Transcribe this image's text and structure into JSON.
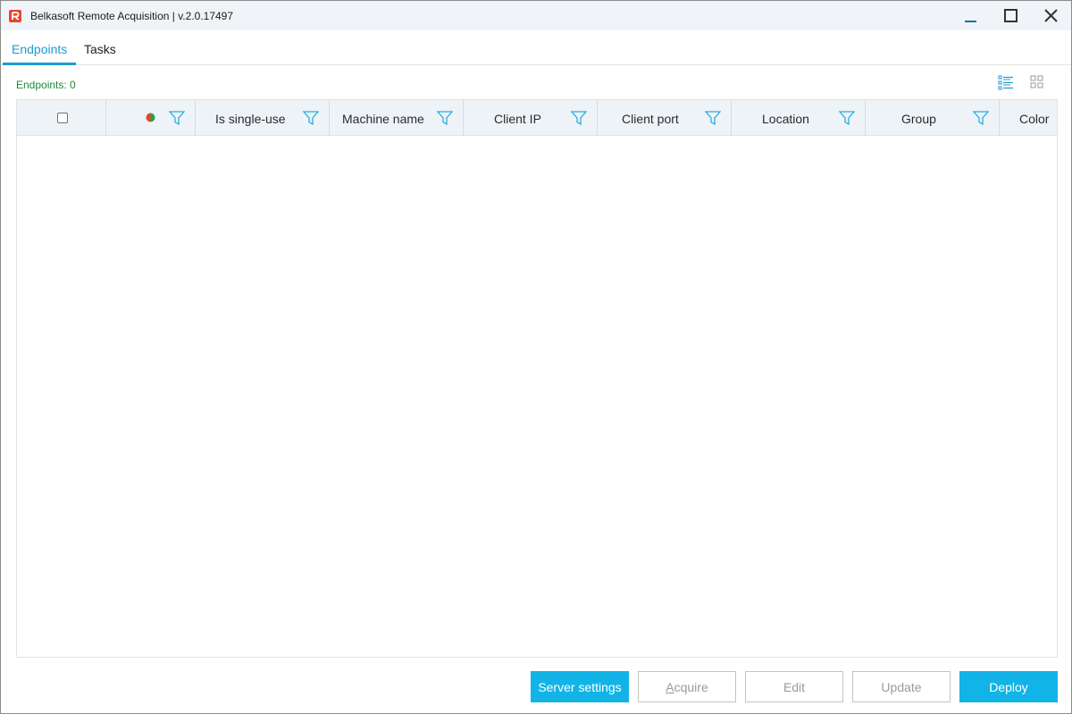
{
  "window": {
    "title": "Belkasoft Remote Acquisition | v.2.0.17497",
    "brand_color": "#e8452c",
    "accent_color": "#1d9bd1"
  },
  "tabs": [
    {
      "label": "Endpoints",
      "active": true
    },
    {
      "label": "Tasks",
      "active": false
    }
  ],
  "endpoints": {
    "count_label": "Endpoints: 0",
    "view_modes": [
      "list-view-icon",
      "tile-view-icon"
    ]
  },
  "grid": {
    "columns": [
      {
        "label": "",
        "type": "checkbox"
      },
      {
        "label": "",
        "type": "status"
      },
      {
        "label": "Is single-use"
      },
      {
        "label": "Machine name"
      },
      {
        "label": "Client IP"
      },
      {
        "label": "Client port"
      },
      {
        "label": "Location"
      },
      {
        "label": "Group"
      },
      {
        "label": "Color"
      }
    ],
    "rows": []
  },
  "buttons": {
    "server_settings": "Server settings",
    "acquire": "Acquire",
    "edit": "Edit",
    "update": "Update",
    "deploy": "Deploy"
  }
}
